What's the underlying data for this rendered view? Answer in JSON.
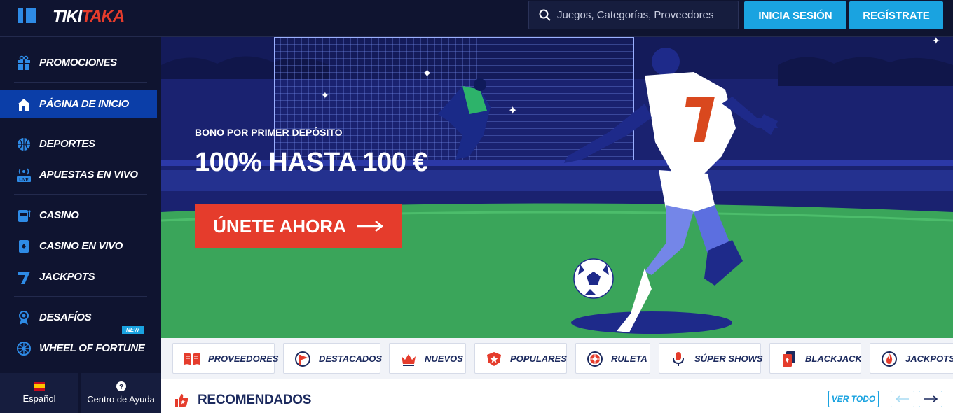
{
  "brand": {
    "logo_part1": "TIKI",
    "logo_part2": "TAKA"
  },
  "header": {
    "search_placeholder": "Juegos, Categorías, Proveedores",
    "login_label": "INICIA SESIÓN",
    "register_label": "REGÍSTRATE"
  },
  "sidebar": {
    "items": [
      {
        "label": "PROMOCIONES",
        "icon": "gift-icon"
      },
      {
        "label": "PÁGINA DE INICIO",
        "icon": "home-icon",
        "active": true
      },
      {
        "label": "DEPORTES",
        "icon": "basketball-icon"
      },
      {
        "label": "APUESTAS EN VIVO",
        "icon": "live-broadcast-icon"
      },
      {
        "label": "CASINO",
        "icon": "slot-machine-icon"
      },
      {
        "label": "CASINO EN VIVO",
        "icon": "cards-icon"
      },
      {
        "label": "JACKPOTS",
        "icon": "seven-icon"
      },
      {
        "label": "DESAFÍOS",
        "icon": "medal-icon"
      },
      {
        "label": "WHEEL OF FORTUNE",
        "icon": "wheel-icon",
        "badge": "NEW"
      }
    ],
    "language_label": "Español",
    "help_label": "Centro de Ayuda"
  },
  "hero": {
    "subtitle": "BONO POR PRIMER DEPÓSITO",
    "title": "100% HASTA 100 €",
    "cta_label": "ÚNETE AHORA"
  },
  "categories": [
    {
      "label": "PROVEEDORES",
      "icon": "book-icon"
    },
    {
      "label": "DESTACADOS",
      "icon": "flag-icon"
    },
    {
      "label": "NUEVOS",
      "icon": "crown-icon"
    },
    {
      "label": "POPULARES",
      "icon": "star-badge-icon"
    },
    {
      "label": "RULETA",
      "icon": "roulette-icon"
    },
    {
      "label": "SÚPER SHOWS",
      "icon": "microphone-icon"
    },
    {
      "label": "BLACKJACK",
      "icon": "playing-card-icon"
    },
    {
      "label": "JACKPOTS",
      "icon": "flame-icon"
    }
  ],
  "recommended": {
    "title": "RECOMENDADOS",
    "view_all_label": "VER TODO"
  },
  "colors": {
    "accent_blue": "#1aa3e0",
    "cta_red": "#e53c2c",
    "nav_active": "#0b3ea8",
    "background": "#0f1430"
  }
}
